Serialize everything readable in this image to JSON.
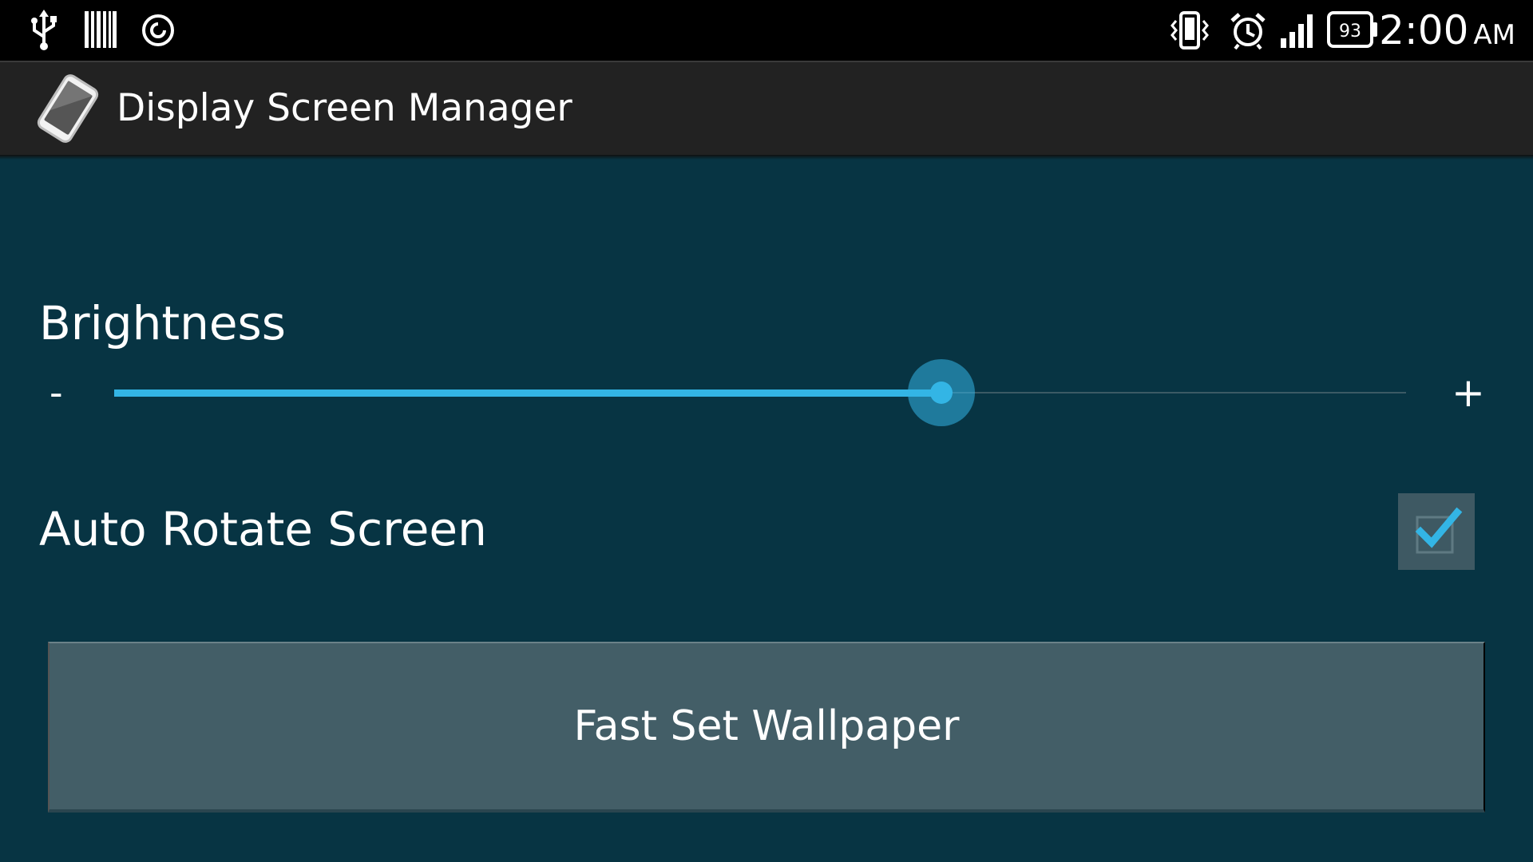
{
  "status_bar": {
    "battery_level": "93",
    "time": "2:00",
    "ampm": "AM",
    "left_icons": [
      "usb-icon",
      "barcode-icon",
      "circle-at-icon"
    ],
    "right_icons": [
      "vibrate-icon",
      "alarm-icon",
      "signal-icon",
      "battery-icon"
    ]
  },
  "action_bar": {
    "title": "Display Screen Manager",
    "icon": "phone-icon"
  },
  "brightness": {
    "label": "Brightness",
    "minus": "-",
    "plus": "+",
    "value": 0.64
  },
  "auto_rotate": {
    "label": "Auto Rotate Screen",
    "checked": true
  },
  "wallpaper_button": {
    "label": "Fast Set Wallpaper"
  },
  "colors": {
    "background": "#073443",
    "accent": "#33b5e5",
    "action_bar": "#222222",
    "button": "#435e67"
  }
}
